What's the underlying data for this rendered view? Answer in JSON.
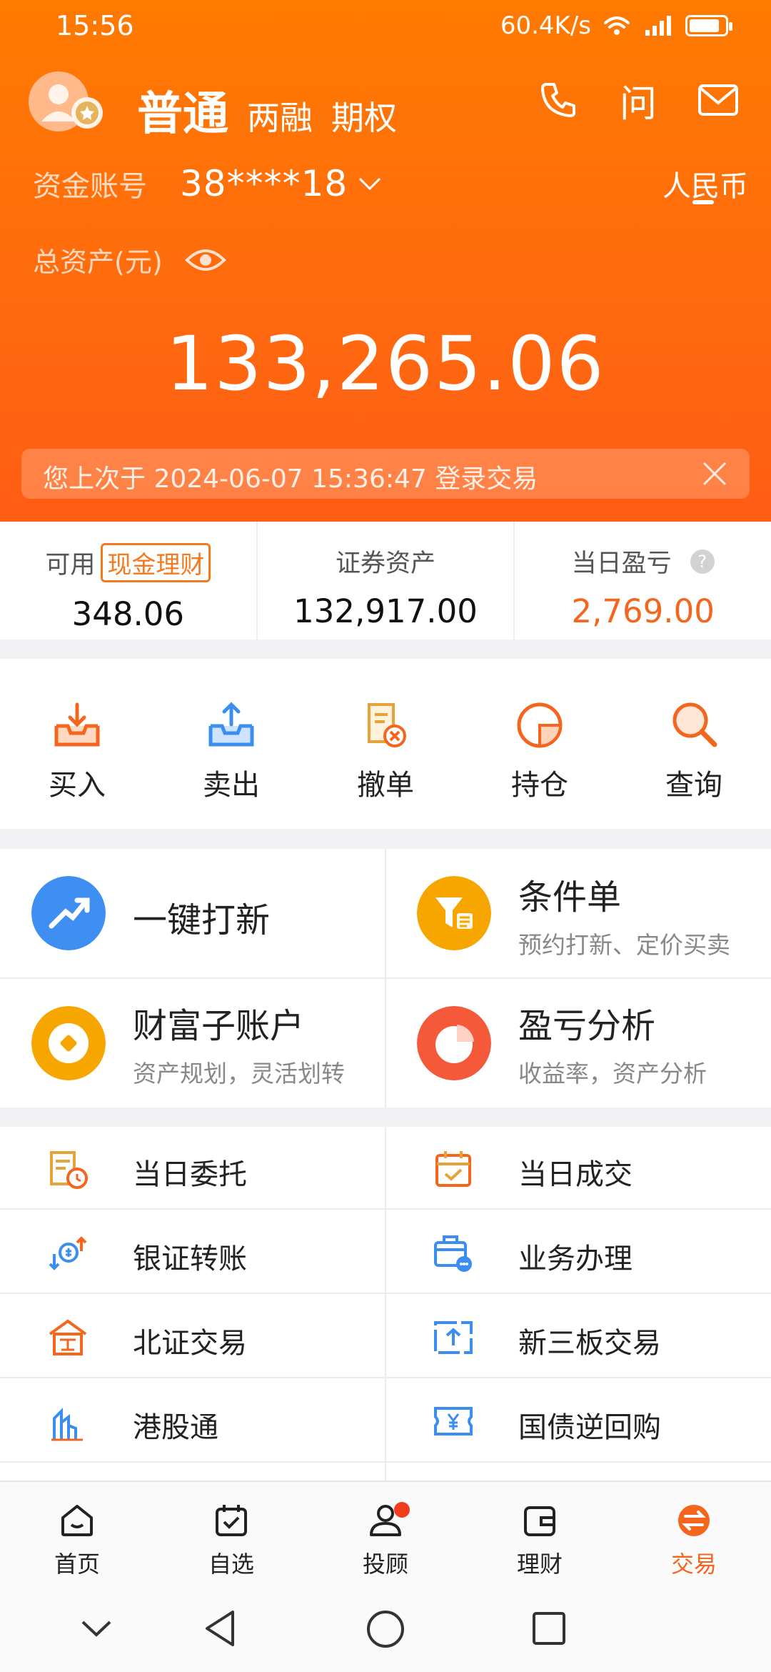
{
  "status": {
    "time": "15:56",
    "speed": "60.4K/s",
    "battery_level": 0.85
  },
  "header": {
    "tab_normal": "普通",
    "tab_margin": "两融",
    "tab_options": "期权",
    "ask_label": "问"
  },
  "account": {
    "label": "资金账号",
    "number": "38****18",
    "currency": "人民币"
  },
  "assets": {
    "label": "总资产(元)",
    "total": "133,265.06"
  },
  "notice": {
    "text": "您上次于 2024-06-07  15:36:47 登录交易"
  },
  "stats": {
    "available_label": "可用",
    "cash_tag": "现金理财",
    "available_value": "348.06",
    "securities_label": "证券资产",
    "securities_value": "132,917.00",
    "pnl_label": "当日盈亏",
    "pnl_help": "?",
    "pnl_value": "2,769.00"
  },
  "actions": {
    "buy": "买入",
    "sell": "卖出",
    "cancel": "撤单",
    "position": "持仓",
    "query": "查询"
  },
  "features": {
    "ipo": {
      "title": "一键打新"
    },
    "condition": {
      "title": "条件单",
      "sub": "预约打新、定价买卖"
    },
    "wealth": {
      "title": "财富子账户",
      "sub": "资产规划，灵活划转"
    },
    "pnl": {
      "title": "盈亏分析",
      "sub": "收益率，资产分析"
    }
  },
  "list": {
    "entrust": "当日委托",
    "deal": "当日成交",
    "transfer": "银证转账",
    "business": "业务办理",
    "bse": "北证交易",
    "neeq": "新三板交易",
    "hk": "港股通",
    "repo": "国债逆回购"
  },
  "tabbar": {
    "home": "首页",
    "watch": "自选",
    "advisor": "投顾",
    "finance": "理财",
    "trade": "交易"
  },
  "colors": {
    "brand": "#ff6a10",
    "accent": "#f4661e",
    "blue": "#3a8ef0"
  }
}
